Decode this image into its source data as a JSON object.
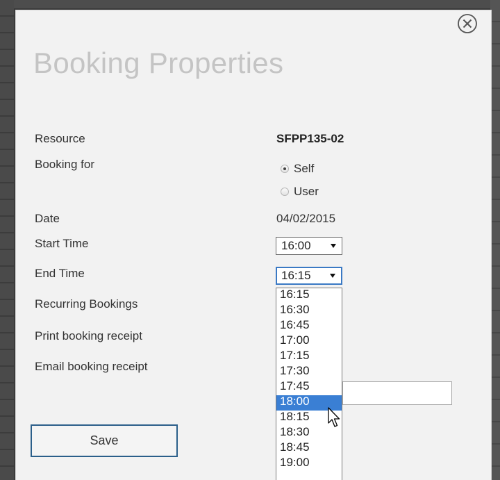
{
  "dialog": {
    "title": "Booking Properties",
    "close_icon": "circle-x-icon"
  },
  "form": {
    "resource": {
      "label": "Resource",
      "value": "SFPP135-02"
    },
    "booking_for": {
      "label": "Booking for",
      "options": [
        {
          "label": "Self",
          "checked": true
        },
        {
          "label": "User",
          "checked": false
        }
      ]
    },
    "date": {
      "label": "Date",
      "value": "04/02/2015"
    },
    "start_time": {
      "label": "Start Time",
      "value": "16:00"
    },
    "end_time": {
      "label": "End Time",
      "value": "16:15"
    },
    "recurring": {
      "label": "Recurring Bookings"
    },
    "print_receipt": {
      "label": "Print booking receipt"
    },
    "email_receipt": {
      "label": "Email booking receipt"
    },
    "email_input": {
      "value": ""
    }
  },
  "dropdown": {
    "options": [
      "16:15",
      "16:30",
      "16:45",
      "17:00",
      "17:15",
      "17:30",
      "17:45",
      "18:00",
      "18:15",
      "18:30",
      "18:45",
      "19:00"
    ],
    "highlighted": "18:00"
  },
  "actions": {
    "save_label": "Save"
  },
  "colors": {
    "highlight": "#3a7fd4",
    "focus_border": "#3a79c4",
    "save_border": "#2b5f8a",
    "title": "#c4c4c4"
  }
}
